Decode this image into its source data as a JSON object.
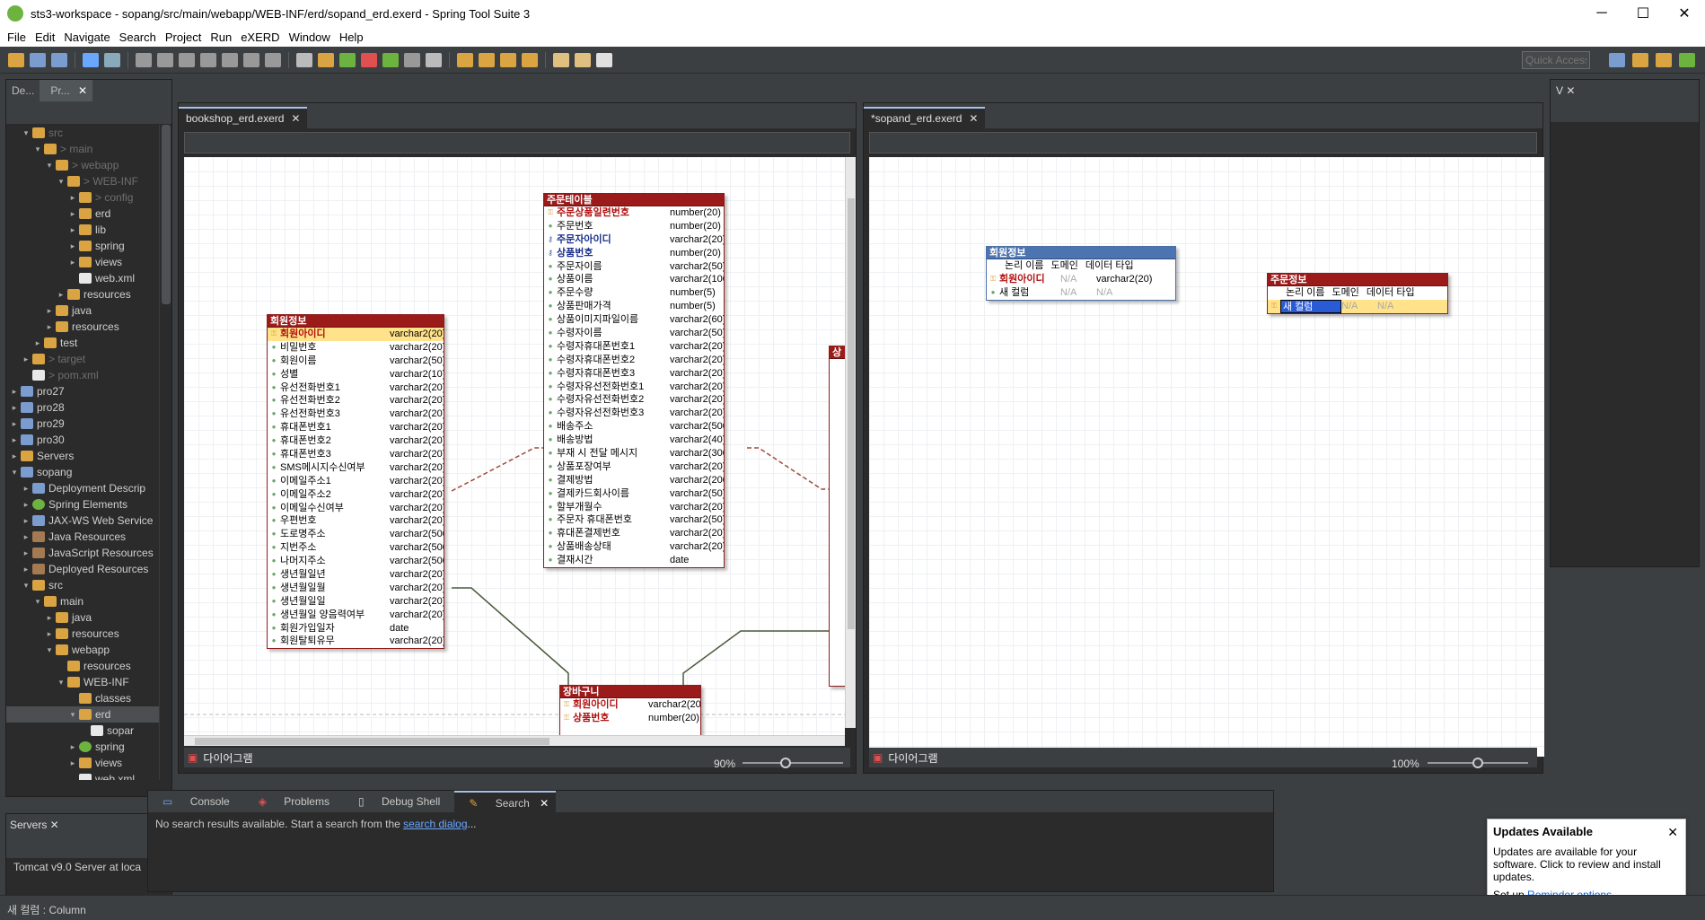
{
  "window": {
    "title": "sts3-workspace - sopang/src/main/webapp/WEB-INF/erd/sopand_erd.exerd - Spring Tool Suite 3",
    "minimize": "─",
    "maximize": "☐",
    "close": "✕"
  },
  "menu": [
    "File",
    "Edit",
    "Navigate",
    "Search",
    "Project",
    "Run",
    "eXERD",
    "Window",
    "Help"
  ],
  "toolbar": {
    "quick_access_placeholder": "Quick Access"
  },
  "left_panel": {
    "tabs": [
      "De...",
      "Pr..."
    ],
    "tree": [
      {
        "depth": 1,
        "arrow": "▾",
        "icon": "folder",
        "label": "src",
        "dim": true
      },
      {
        "depth": 2,
        "arrow": "▾",
        "icon": "folder",
        "label": "> main",
        "dim": true
      },
      {
        "depth": 3,
        "arrow": "▾",
        "icon": "folder",
        "label": "> webapp",
        "dim": true
      },
      {
        "depth": 4,
        "arrow": "▾",
        "icon": "folder",
        "label": "> WEB-INF",
        "dim": true
      },
      {
        "depth": 5,
        "arrow": "▸",
        "icon": "folder",
        "label": "> config",
        "dim": true
      },
      {
        "depth": 5,
        "arrow": "▸",
        "icon": "folder",
        "label": "erd"
      },
      {
        "depth": 5,
        "arrow": "▸",
        "icon": "folder",
        "label": "lib"
      },
      {
        "depth": 5,
        "arrow": "▸",
        "icon": "folder",
        "label": "spring"
      },
      {
        "depth": 5,
        "arrow": "▸",
        "icon": "folder",
        "label": "views"
      },
      {
        "depth": 5,
        "arrow": "",
        "icon": "file",
        "label": "web.xml"
      },
      {
        "depth": 4,
        "arrow": "▸",
        "icon": "folder",
        "label": "resources"
      },
      {
        "depth": 3,
        "arrow": "▸",
        "icon": "folder",
        "label": "java"
      },
      {
        "depth": 3,
        "arrow": "▸",
        "icon": "folder",
        "label": "resources"
      },
      {
        "depth": 2,
        "arrow": "▸",
        "icon": "folder",
        "label": "test"
      },
      {
        "depth": 1,
        "arrow": "▸",
        "icon": "folder",
        "label": "> target",
        "dim": true
      },
      {
        "depth": 1,
        "arrow": "",
        "icon": "file",
        "label": "> pom.xml",
        "dim": true
      },
      {
        "depth": 0,
        "arrow": "▸",
        "icon": "proj",
        "label": "pro27"
      },
      {
        "depth": 0,
        "arrow": "▸",
        "icon": "proj",
        "label": "pro28"
      },
      {
        "depth": 0,
        "arrow": "▸",
        "icon": "proj",
        "label": "pro29"
      },
      {
        "depth": 0,
        "arrow": "▸",
        "icon": "proj",
        "label": "pro30"
      },
      {
        "depth": 0,
        "arrow": "▸",
        "icon": "folder",
        "label": "Servers"
      },
      {
        "depth": 0,
        "arrow": "▾",
        "icon": "proj",
        "label": "sopang"
      },
      {
        "depth": 1,
        "arrow": "▸",
        "icon": "proj",
        "label": "Deployment Descrip"
      },
      {
        "depth": 1,
        "arrow": "▸",
        "icon": "spring",
        "label": "Spring Elements"
      },
      {
        "depth": 1,
        "arrow": "▸",
        "icon": "proj",
        "label": "JAX-WS Web Service"
      },
      {
        "depth": 1,
        "arrow": "▸",
        "icon": "jar",
        "label": "Java Resources"
      },
      {
        "depth": 1,
        "arrow": "▸",
        "icon": "jar",
        "label": "JavaScript Resources"
      },
      {
        "depth": 1,
        "arrow": "▸",
        "icon": "jar",
        "label": "Deployed Resources"
      },
      {
        "depth": 1,
        "arrow": "▾",
        "icon": "folder",
        "label": "src"
      },
      {
        "depth": 2,
        "arrow": "▾",
        "icon": "folder",
        "label": "main"
      },
      {
        "depth": 3,
        "arrow": "▸",
        "icon": "folder",
        "label": "java"
      },
      {
        "depth": 3,
        "arrow": "▸",
        "icon": "folder",
        "label": "resources"
      },
      {
        "depth": 3,
        "arrow": "▾",
        "icon": "folder",
        "label": "webapp"
      },
      {
        "depth": 4,
        "arrow": "",
        "icon": "folder",
        "label": "resources"
      },
      {
        "depth": 4,
        "arrow": "▾",
        "icon": "folder",
        "label": "WEB-INF"
      },
      {
        "depth": 5,
        "arrow": "",
        "icon": "folder",
        "label": "classes"
      },
      {
        "depth": 5,
        "arrow": "▾",
        "icon": "folder",
        "label": "erd",
        "selected": true
      },
      {
        "depth": 6,
        "arrow": "",
        "icon": "file",
        "label": "sopar"
      },
      {
        "depth": 5,
        "arrow": "▸",
        "icon": "spring",
        "label": "spring"
      },
      {
        "depth": 5,
        "arrow": "▸",
        "icon": "folder",
        "label": "views"
      },
      {
        "depth": 5,
        "arrow": "",
        "icon": "file",
        "label": "web.xml"
      }
    ]
  },
  "servers_panel": {
    "tab": "Servers",
    "row": "Tomcat v9.0 Server at loca"
  },
  "status_bar": "새 컬럼 : Column",
  "editor_left": {
    "tab": "bookshop_erd.exerd",
    "bottom_label": "다이어그램",
    "zoom": "90%",
    "tables": {
      "order_table": {
        "name": "주문테이블",
        "rows": [
          {
            "k": "pk",
            "n": "주문상품일련번호",
            "t": "number(20)"
          },
          {
            "k": "",
            "n": "주문번호",
            "t": "number(20)"
          },
          {
            "k": "fk",
            "n": "주문자아이디",
            "t": "varchar2(20)"
          },
          {
            "k": "fk",
            "n": "상품번호",
            "t": "number(20)"
          },
          {
            "k": "",
            "n": "주문자이름",
            "t": "varchar2(50)"
          },
          {
            "k": "",
            "n": "상품이름",
            "t": "varchar2(100)"
          },
          {
            "k": "",
            "n": "주문수량",
            "t": "number(5)"
          },
          {
            "k": "",
            "n": "상품판매가격",
            "t": "number(5)"
          },
          {
            "k": "",
            "n": "상품이미지파일이름",
            "t": "varchar2(60)"
          },
          {
            "k": "",
            "n": "수령자이름",
            "t": "varchar2(50)"
          },
          {
            "k": "",
            "n": "수령자휴대폰번호1",
            "t": "varchar2(20)"
          },
          {
            "k": "",
            "n": "수령자휴대폰번호2",
            "t": "varchar2(20)"
          },
          {
            "k": "",
            "n": "수령자휴대폰번호3",
            "t": "varchar2(20)"
          },
          {
            "k": "",
            "n": "수령자유선전화번호1",
            "t": "varchar2(20)"
          },
          {
            "k": "",
            "n": "수령자유선전화번호2",
            "t": "varchar2(20)"
          },
          {
            "k": "",
            "n": "수령자유선전화번호3",
            "t": "varchar2(20)"
          },
          {
            "k": "",
            "n": "배송주소",
            "t": "varchar2(500)"
          },
          {
            "k": "",
            "n": "배송방법",
            "t": "varchar2(40)"
          },
          {
            "k": "",
            "n": "부재 시 전달 메시지",
            "t": "varchar2(300)"
          },
          {
            "k": "",
            "n": "상품포장여부",
            "t": "varchar2(20)"
          },
          {
            "k": "",
            "n": "결제방법",
            "t": "varchar2(200)"
          },
          {
            "k": "",
            "n": "결제카드회사이름",
            "t": "varchar2(50)"
          },
          {
            "k": "",
            "n": "할부개월수",
            "t": "varchar2(20)"
          },
          {
            "k": "",
            "n": "주문자 휴대폰번호",
            "t": "varchar2(50)"
          },
          {
            "k": "",
            "n": "휴대폰결제번호",
            "t": "varchar2(20)"
          },
          {
            "k": "",
            "n": "상품배송상태",
            "t": "varchar2(20)"
          },
          {
            "k": "",
            "n": "결재시간",
            "t": "date"
          }
        ]
      },
      "member_table": {
        "name": "회원정보",
        "rows": [
          {
            "k": "pk",
            "n": "회원아이디",
            "t": "varchar2(20)",
            "sel": true
          },
          {
            "k": "",
            "n": "비밀번호",
            "t": "varchar2(20)"
          },
          {
            "k": "",
            "n": "회원이름",
            "t": "varchar2(50)"
          },
          {
            "k": "",
            "n": "성별",
            "t": "varchar2(10)"
          },
          {
            "k": "",
            "n": "유선전화번호1",
            "t": "varchar2(20)"
          },
          {
            "k": "",
            "n": "유선전화번호2",
            "t": "varchar2(20)"
          },
          {
            "k": "",
            "n": "유선전화번호3",
            "t": "varchar2(20)"
          },
          {
            "k": "",
            "n": "휴대폰번호1",
            "t": "varchar2(20)"
          },
          {
            "k": "",
            "n": "휴대폰번호2",
            "t": "varchar2(20)"
          },
          {
            "k": "",
            "n": "휴대폰번호3",
            "t": "varchar2(20)"
          },
          {
            "k": "",
            "n": "SMS메시지수신여부",
            "t": "varchar2(20)"
          },
          {
            "k": "",
            "n": "이메일주소1",
            "t": "varchar2(20)"
          },
          {
            "k": "",
            "n": "이메일주소2",
            "t": "varchar2(20)"
          },
          {
            "k": "",
            "n": "이메일수신여부",
            "t": "varchar2(20)"
          },
          {
            "k": "",
            "n": "우편번호",
            "t": "varchar2(20)"
          },
          {
            "k": "",
            "n": "도로명주소",
            "t": "varchar2(500)"
          },
          {
            "k": "",
            "n": "지번주소",
            "t": "varchar2(500)"
          },
          {
            "k": "",
            "n": "나머지주소",
            "t": "varchar2(500)"
          },
          {
            "k": "",
            "n": "생년월일년",
            "t": "varchar2(20)"
          },
          {
            "k": "",
            "n": "생년월일월",
            "t": "varchar2(20)"
          },
          {
            "k": "",
            "n": "생년월일일",
            "t": "varchar2(20)"
          },
          {
            "k": "",
            "n": "생년월일 양음력여부",
            "t": "varchar2(20)"
          },
          {
            "k": "",
            "n": "회원가입일자",
            "t": "date"
          },
          {
            "k": "",
            "n": "회원탈퇴유무",
            "t": "varchar2(20)"
          }
        ]
      },
      "cart_table": {
        "name": "장바구니",
        "rows": [
          {
            "k": "pk",
            "n": "회원아이디",
            "t": "varchar2(20)"
          },
          {
            "k": "pk",
            "n": "상품번호",
            "t": "number(20)"
          }
        ]
      },
      "partial_table": {
        "name": "상"
      }
    }
  },
  "editor_right": {
    "tab": "*sopand_erd.exerd",
    "bottom_label": "다이어그램",
    "zoom": "100%",
    "member": {
      "name": "회원정보",
      "header": [
        "논리 이름",
        "도메인",
        "데이터 타입"
      ],
      "rows": [
        {
          "k": "pk",
          "n": "회원아이디",
          "d": "N/A",
          "t": "varchar2(20)"
        },
        {
          "k": "",
          "n": "새 컬럼",
          "d": "N/A",
          "t": "N/A"
        }
      ]
    },
    "order": {
      "name": "주문정보",
      "header": [
        "논리 이름",
        "도메인",
        "데이터 타입"
      ],
      "rows": [
        {
          "k": "pk",
          "n": "새 컬럼",
          "d": "N/A",
          "t": "N/A",
          "sel": true
        }
      ]
    }
  },
  "bottom_panel": {
    "tabs": [
      "Console",
      "Problems",
      "Debug Shell",
      "Search"
    ],
    "message": "No search results available. Start a search from the ",
    "link": "search dialog",
    "suffix": "..."
  },
  "right_panel": {
    "tab": "V"
  },
  "notification": {
    "title": "Updates Available",
    "body": "Updates are available for your software. Click to review and install updates.",
    "setup": "Set up",
    "link": "Reminder options"
  },
  "colors": {
    "table_head": "#9b1a1a",
    "table_head_blue": "#4c74b0",
    "pk_icon": "#d9a441",
    "link": "#1a66d1"
  }
}
